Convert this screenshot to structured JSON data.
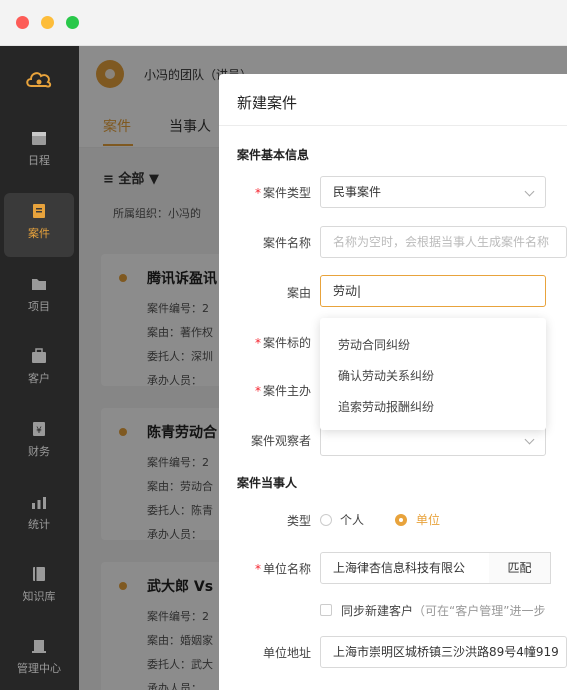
{
  "sidebar": {
    "items": [
      {
        "label": "日程",
        "icon": "calendar-icon"
      },
      {
        "label": "案件",
        "icon": "case-icon"
      },
      {
        "label": "项目",
        "icon": "folder-icon"
      },
      {
        "label": "客户",
        "icon": "client-icon"
      },
      {
        "label": "财务",
        "icon": "finance-icon"
      },
      {
        "label": "统计",
        "icon": "chart-icon"
      },
      {
        "label": "知识库",
        "icon": "book-icon"
      },
      {
        "label": "管理中心",
        "icon": "building-icon"
      }
    ]
  },
  "header": {
    "team_name": "小冯的团队（讲员）"
  },
  "tabs": [
    "案件",
    "当事人"
  ],
  "filter": {
    "label": "全部"
  },
  "org_label": "所属组织：小冯的",
  "cards": [
    {
      "title": "腾讯诉盈讯",
      "lines": [
        "案件编号：2",
        "案由：著作权",
        "委托人：深圳",
        "承办人员："
      ]
    },
    {
      "title": "陈青劳动合",
      "lines": [
        "案件编号：2",
        "案由：劳动合",
        "委托人：陈青",
        "承办人员："
      ]
    },
    {
      "title": "武大郎 Vs",
      "lines": [
        "案件编号：2",
        "案由：婚姻家",
        "委托人：武大",
        "承办人员："
      ]
    }
  ],
  "modal": {
    "title": "新建案件",
    "section_basic": "案件基本信息",
    "fields": {
      "case_type": {
        "label": "案件类型",
        "value": "民事案件"
      },
      "case_name": {
        "label": "案件名称",
        "placeholder": "名称为空时，会根据当事人生成案件名称"
      },
      "cause": {
        "label": "案由",
        "value": "劳动"
      },
      "subject": {
        "label": "案件标的"
      },
      "host": {
        "label": "案件主办"
      },
      "observer": {
        "label": "案件观察者"
      }
    },
    "cause_options": [
      "劳动合同纠纷",
      "确认劳动关系纠纷",
      "追索劳动报酬纠纷"
    ],
    "section_party": "案件当事人",
    "party": {
      "type_label": "类型",
      "type_options": [
        "个人",
        "单位"
      ],
      "selected": "单位",
      "unit_label": "单位名称",
      "unit_value": "上海律杏信息科技有限公",
      "match_label": "匹配",
      "sync_label": "同步新建客户",
      "sync_hint": "（可在“客户管理”进一步",
      "address_label": "单位地址",
      "address_value": "上海市崇明区城桥镇三沙洪路89号4幢919"
    }
  },
  "colors": {
    "accent": "#e8a33c",
    "sidebar": "#262626"
  }
}
